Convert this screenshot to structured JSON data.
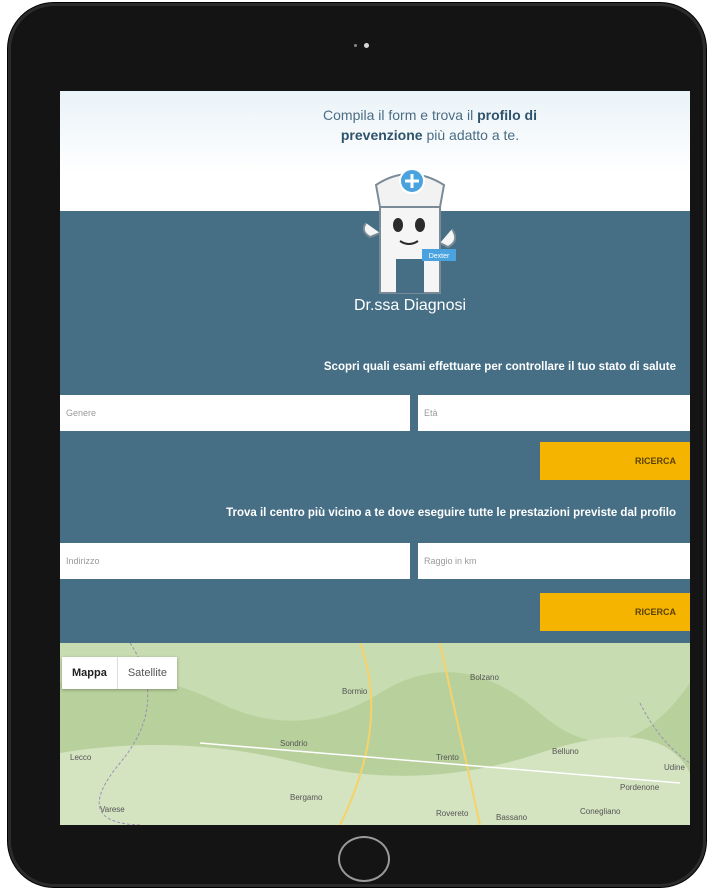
{
  "header": {
    "line1_pre": "Compila il form e trova il ",
    "line1_bold": "profilo di",
    "line2_bold": "prevenzione",
    "line2_post": " più adatto a te."
  },
  "brand": {
    "name": "Dr.ssa Diagnosi",
    "badge": "Dexter"
  },
  "search": {
    "title": "Scopri quali esami effettuare per controllare il tuo stato di salute",
    "gender_placeholder": "Genere",
    "age_placeholder": "Età",
    "button_label": "RICERCA"
  },
  "centers": {
    "title": "Trova il centro più vicino a te dove eseguire tutte le prestazioni previste dal profilo",
    "address_placeholder": "Indirizzo",
    "radius_placeholder": "Raggio in km",
    "button_label": "RICERCA"
  },
  "map": {
    "toggle_map": "Mappa",
    "toggle_satellite": "Satellite",
    "places": [
      "Bormio",
      "Bolzano",
      "Sondrio",
      "Trento",
      "Belluno",
      "Lecco",
      "Bergamo",
      "Varese",
      "Rovereto",
      "Bassano",
      "Pordenone",
      "Conegliano",
      "Udine"
    ]
  },
  "colors": {
    "panel": "#466f85",
    "button": "#f4b400",
    "text_heading": "#2e546b"
  }
}
